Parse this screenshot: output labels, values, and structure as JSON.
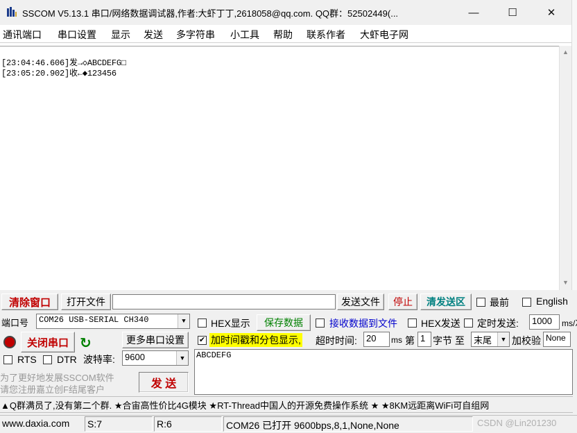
{
  "window": {
    "title": "SSCOM V5.13.1 串口/网络数据调试器,作者:大虾丁丁,2618058@qq.com. QQ群：52502449(...",
    "minimize": "—",
    "maximize": "☐",
    "close": "✕"
  },
  "menu": [
    "通讯端口",
    "串口设置",
    "显示",
    "发送",
    "多字符串",
    "小工具",
    "帮助",
    "联系作者",
    "大虾电子网"
  ],
  "receive": {
    "lines": [
      "[23:04:46.606]发→◇ABCDEFG□",
      "[23:05:20.902]收←◆123456"
    ]
  },
  "toolbar1": {
    "clear_window": "清除窗口",
    "open_file": "打开文件",
    "send_file": "发送文件",
    "stop": "停止",
    "clear_send": "清发送区",
    "front": "最前",
    "english": "English"
  },
  "port": {
    "label": "端口号",
    "value": "COM26 USB-SERIAL CH340",
    "close_port": "关闭串口",
    "more_settings": "更多串口设置",
    "rts": "RTS",
    "dtr": "DTR",
    "baud_label": "波特率:",
    "baud_value": "9600"
  },
  "options": {
    "hex_display": "HEX显示",
    "save_data": "保存数据",
    "recv_to_file": "接收数据到文件",
    "hex_send": "HEX发送",
    "timed_send": "定时发送:",
    "timed_value": "1000",
    "timed_unit": "ms/次",
    "add_timestamp": "加时间戳和分包显示,",
    "timeout_label": "超时时间:",
    "timeout_value": "20",
    "timeout_unit": "ms",
    "byte_prefix": "第",
    "byte_value": "1",
    "byte_suffix": "字节 至",
    "end_value": "末尾",
    "checksum_label": "加校验",
    "checksum_value": "None"
  },
  "send_area": {
    "text": "ABCDEFG"
  },
  "promo": {
    "line1": "为了更好地发展SSCOM软件",
    "line2": "请您注册嘉立创F结尾客户",
    "send_button": "发  送"
  },
  "ticker": "▲Q群满员了,没有第二个群. ★合宙高性价比4G模块 ★RT-Thread中国人的开源免费操作系统 ★ ★8KM远距离WiFi可自组网",
  "status": {
    "website": "www.daxia.com",
    "sent": "S:7",
    "received": "R:6",
    "port_state": "COM26 已打开  9600bps,8,1,None,None",
    "watermark": "CSDN @Lin201230"
  },
  "colors": {
    "accent_red": "#c00000",
    "accent_green": "#008000",
    "highlight_yellow": "#ffff00",
    "link_blue": "#0000cc"
  }
}
